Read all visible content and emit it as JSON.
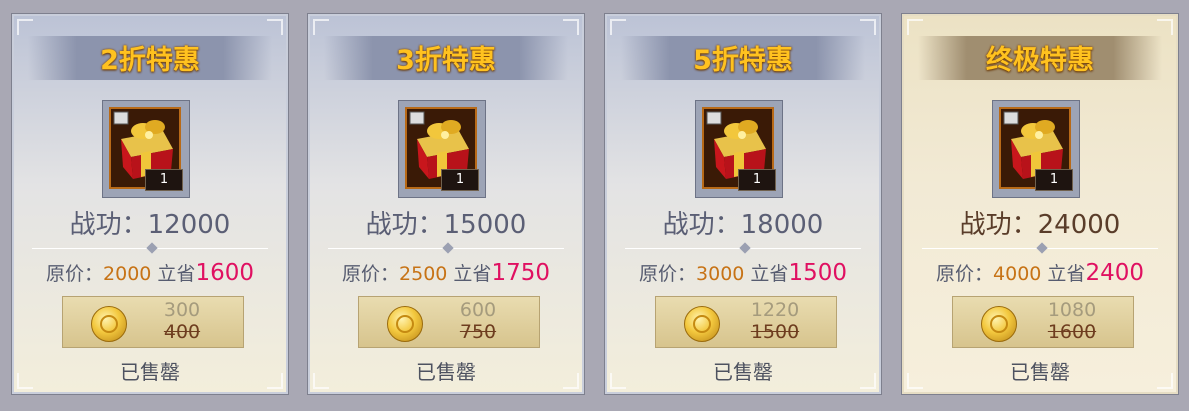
{
  "cards": [
    {
      "title": "2折特惠",
      "power_label": "战功：",
      "power_value": "12000",
      "orig_label": "原价：",
      "orig_value": "2000",
      "save_label": "立省",
      "save_value": "1600",
      "count": "1",
      "price_now": "300",
      "price_old": "400",
      "status": "已售罄"
    },
    {
      "title": "3折特惠",
      "power_label": "战功：",
      "power_value": "15000",
      "orig_label": "原价：",
      "orig_value": "2500",
      "save_label": "立省",
      "save_value": "1750",
      "count": "1",
      "price_now": "600",
      "price_old": "750",
      "status": "已售罄"
    },
    {
      "title": "5折特惠",
      "power_label": "战功：",
      "power_value": "18000",
      "orig_label": "原价：",
      "orig_value": "3000",
      "save_label": "立省",
      "save_value": "1500",
      "count": "1",
      "price_now": "1220",
      "price_old": "1500",
      "status": "已售罄"
    },
    {
      "title": "终极特惠",
      "power_label": "战功：",
      "power_value": "24000",
      "orig_label": "原价：",
      "orig_value": "4000",
      "save_label": "立省",
      "save_value": "2400",
      "count": "1",
      "price_now": "1080",
      "price_old": "1600",
      "status": "已售罄"
    }
  ],
  "icons": {
    "item": "gift-box-icon",
    "currency": "gold-coin-icon"
  },
  "colors": {
    "title": "#ffc21f",
    "save": "#e01061",
    "orig": "#c77316"
  }
}
